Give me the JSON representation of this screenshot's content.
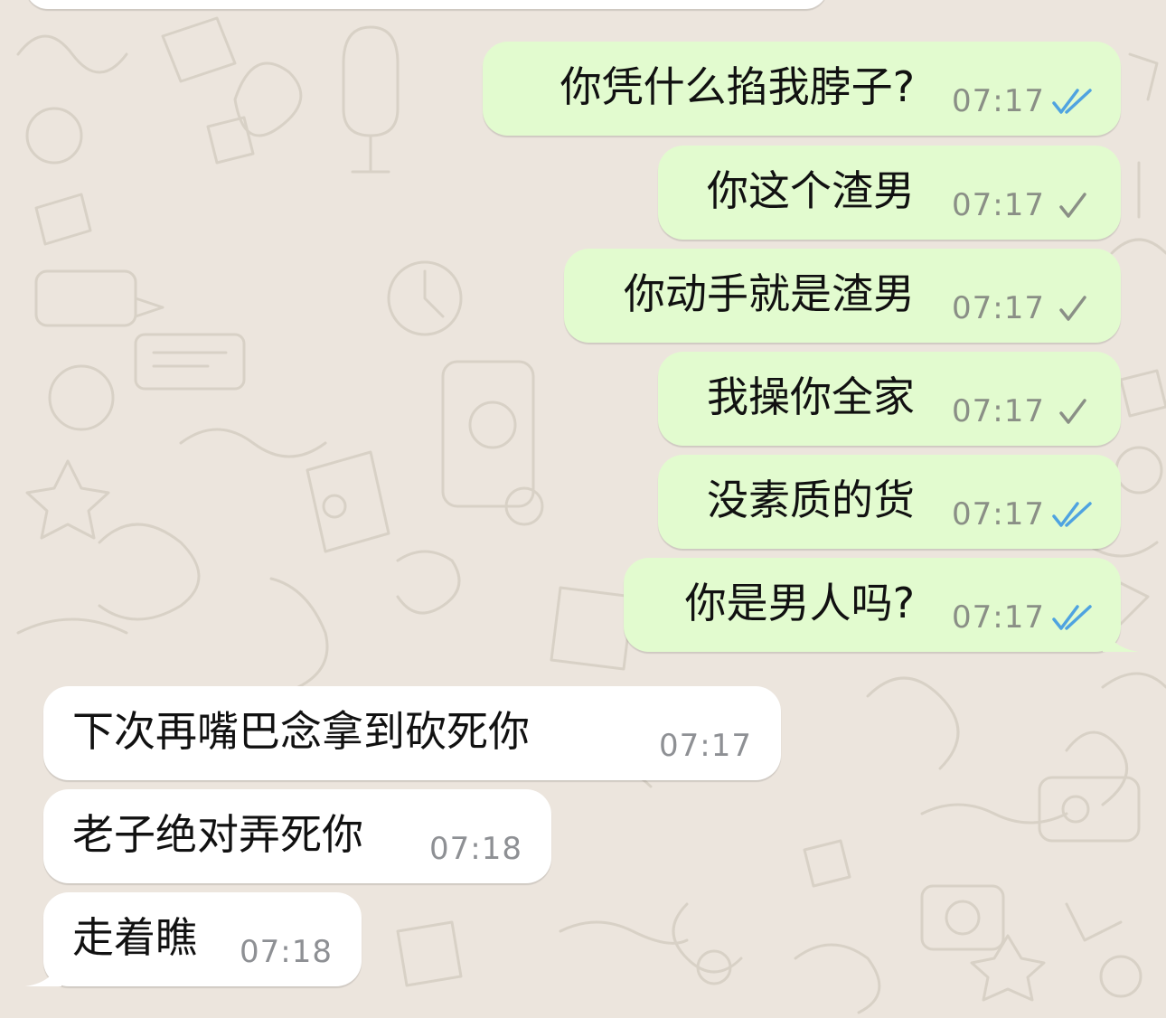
{
  "colors": {
    "wallpaper": "#ECE5DD",
    "outgoing_bubble": "#E2FBCF",
    "incoming_bubble": "#FFFFFF",
    "read_tick": "#4FA3E0",
    "sent_tick": "#8A8F86"
  },
  "messages": [
    {
      "direction": "outgoing",
      "text": "你凭什么掐我脖子?",
      "time": "07:17",
      "status_icon": "double-check-read-icon"
    },
    {
      "direction": "outgoing",
      "text": "你这个渣男",
      "time": "07:17",
      "status_icon": "single-check-icon"
    },
    {
      "direction": "outgoing",
      "text": "你动手就是渣男",
      "time": "07:17",
      "status_icon": "single-check-icon"
    },
    {
      "direction": "outgoing",
      "text": "我操你全家",
      "time": "07:17",
      "status_icon": "single-check-icon"
    },
    {
      "direction": "outgoing",
      "text": "没素质的货",
      "time": "07:17",
      "status_icon": "double-check-read-icon"
    },
    {
      "direction": "outgoing",
      "text": "你是男人吗?",
      "time": "07:17",
      "status_icon": "double-check-read-icon"
    },
    {
      "direction": "incoming",
      "text": "下次再嘴巴念拿到砍死你",
      "time": "07:17"
    },
    {
      "direction": "incoming",
      "text": "老子绝对弄死你",
      "time": "07:18"
    },
    {
      "direction": "incoming",
      "text": "走着瞧",
      "time": "07:18"
    }
  ]
}
